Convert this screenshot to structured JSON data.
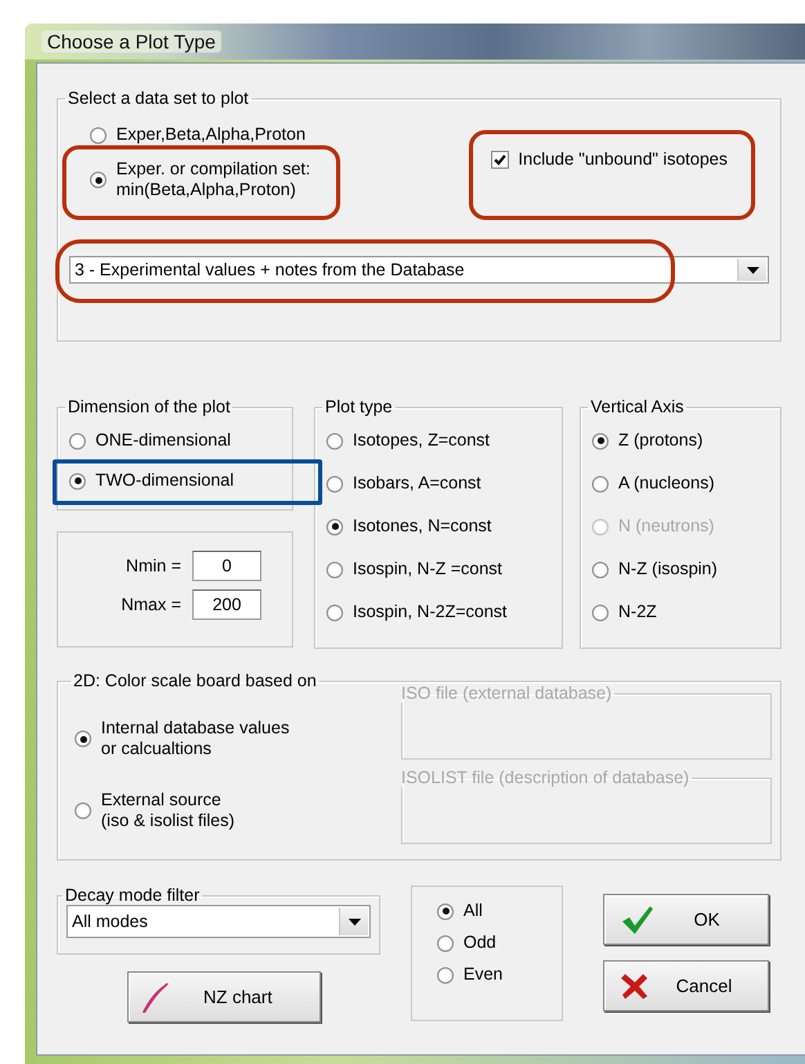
{
  "window": {
    "title": "Choose a Plot Type"
  },
  "data_set": {
    "label": "Select a data set to plot",
    "options": [
      {
        "label": "Exper,Beta,Alpha,Proton",
        "selected": false
      },
      {
        "label": "Exper. or compilation set:\nmin(Beta,Alpha,Proton)",
        "selected": true,
        "color": "#b8300c"
      }
    ],
    "include_unbound": {
      "label": "Include \"unbound\" isotopes",
      "checked": true,
      "color": "#b8300c"
    },
    "source_dropdown": {
      "value": "3 - Experimental values + notes from the Database",
      "color": "#b8300c"
    }
  },
  "dimension": {
    "label": "Dimension of the plot",
    "options": [
      {
        "label": "ONE-dimensional",
        "selected": false
      },
      {
        "label": "TWO-dimensional",
        "selected": true,
        "color": "#0a4c9c"
      }
    ]
  },
  "n_range": {
    "fields": [
      {
        "label": "Nmin =",
        "value": "0"
      },
      {
        "label": "Nmax =",
        "value": "200"
      }
    ]
  },
  "plot_type": {
    "label": "Plot type",
    "options": [
      {
        "label": "Isotopes,  Z=const",
        "selected": false
      },
      {
        "label": "Isobars,  A=const",
        "selected": false
      },
      {
        "label": "Isotones, N=const",
        "selected": true
      },
      {
        "label": "Isospin, N-Z =const",
        "selected": false
      },
      {
        "label": "Isospin, N-2Z=const",
        "selected": false
      }
    ]
  },
  "vertical_axis": {
    "label": "Vertical Axis",
    "options": [
      {
        "label": "Z (protons)",
        "selected": true,
        "disabled": false
      },
      {
        "label": "A (nucleons)",
        "selected": false,
        "disabled": false
      },
      {
        "label": "N (neutrons)",
        "selected": false,
        "disabled": true
      },
      {
        "label": "N-Z (isospin)",
        "selected": false,
        "disabled": false
      },
      {
        "label": "N-2Z",
        "selected": false,
        "disabled": false
      }
    ]
  },
  "color_scale": {
    "label": "2D: Color scale board based on",
    "options": [
      {
        "label": "Internal database values\n or calcualtions",
        "selected": true
      },
      {
        "label": "External source\n (iso & isolist files)",
        "selected": false
      }
    ],
    "files": [
      {
        "label": "ISO file (external database)",
        "disabled": true
      },
      {
        "label": "ISOLIST file  (description of database)",
        "disabled": true
      }
    ]
  },
  "decay_filter": {
    "label": "Decay mode filter",
    "value": "All modes"
  },
  "nz_chart_button": {
    "label": "NZ chart"
  },
  "parity": {
    "options": [
      {
        "label": "All",
        "selected": true
      },
      {
        "label": "Odd",
        "selected": false
      },
      {
        "label": "Even",
        "selected": false
      }
    ]
  },
  "buttons": [
    {
      "kind": "ok",
      "label": "OK"
    },
    {
      "kind": "cancel",
      "label": "Cancel"
    }
  ]
}
